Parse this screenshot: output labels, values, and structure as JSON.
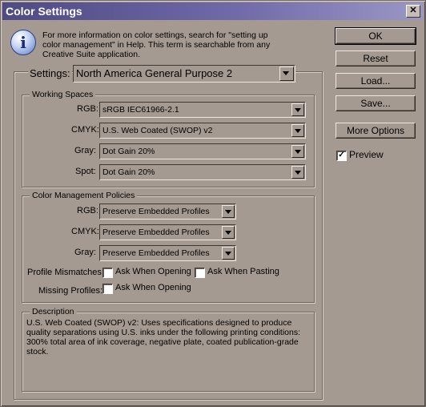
{
  "window": {
    "title": "Color Settings",
    "close_glyph": "✕"
  },
  "info": {
    "icon": "info-icon",
    "lines": [
      "For more information on color settings, search for \"setting up",
      "color management\" in Help. This term is searchable from any",
      "Creative Suite application."
    ]
  },
  "buttons": {
    "ok": "OK",
    "reset": "Reset",
    "load": "Load...",
    "save": "Save...",
    "more_options": "More Options"
  },
  "preview": {
    "label": "Preview",
    "checked": "✓"
  },
  "settings": {
    "label": "Settings:",
    "value": "North America General Purpose 2"
  },
  "working_spaces": {
    "title": "Working Spaces",
    "rgb": {
      "label": "RGB:",
      "value": "sRGB IEC61966-2.1"
    },
    "cmyk": {
      "label": "CMYK:",
      "value": "U.S. Web Coated (SWOP) v2"
    },
    "gray": {
      "label": "Gray:",
      "value": "Dot Gain 20%"
    },
    "spot": {
      "label": "Spot:",
      "value": "Dot Gain 20%"
    }
  },
  "policies": {
    "title": "Color Management Policies",
    "rgb": {
      "label": "RGB:",
      "value": "Preserve Embedded Profiles"
    },
    "cmyk": {
      "label": "CMYK:",
      "value": "Preserve Embedded Profiles"
    },
    "gray": {
      "label": "Gray:",
      "value": "Preserve Embedded Profiles"
    },
    "profile_mismatches": {
      "label": "Profile Mismatches:",
      "ask_opening": "Ask When Opening",
      "ask_pasting": "Ask When Pasting"
    },
    "missing_profiles": {
      "label": "Missing Profiles:",
      "ask_opening": "Ask When Opening"
    }
  },
  "description": {
    "title": "Description",
    "lines": [
      "U.S. Web Coated (SWOP) v2:  Uses specifications designed to produce",
      "quality separations using U.S. inks under the following printing conditions:",
      "300% total area of ink coverage, negative plate, coated publication-grade",
      "stock."
    ]
  }
}
